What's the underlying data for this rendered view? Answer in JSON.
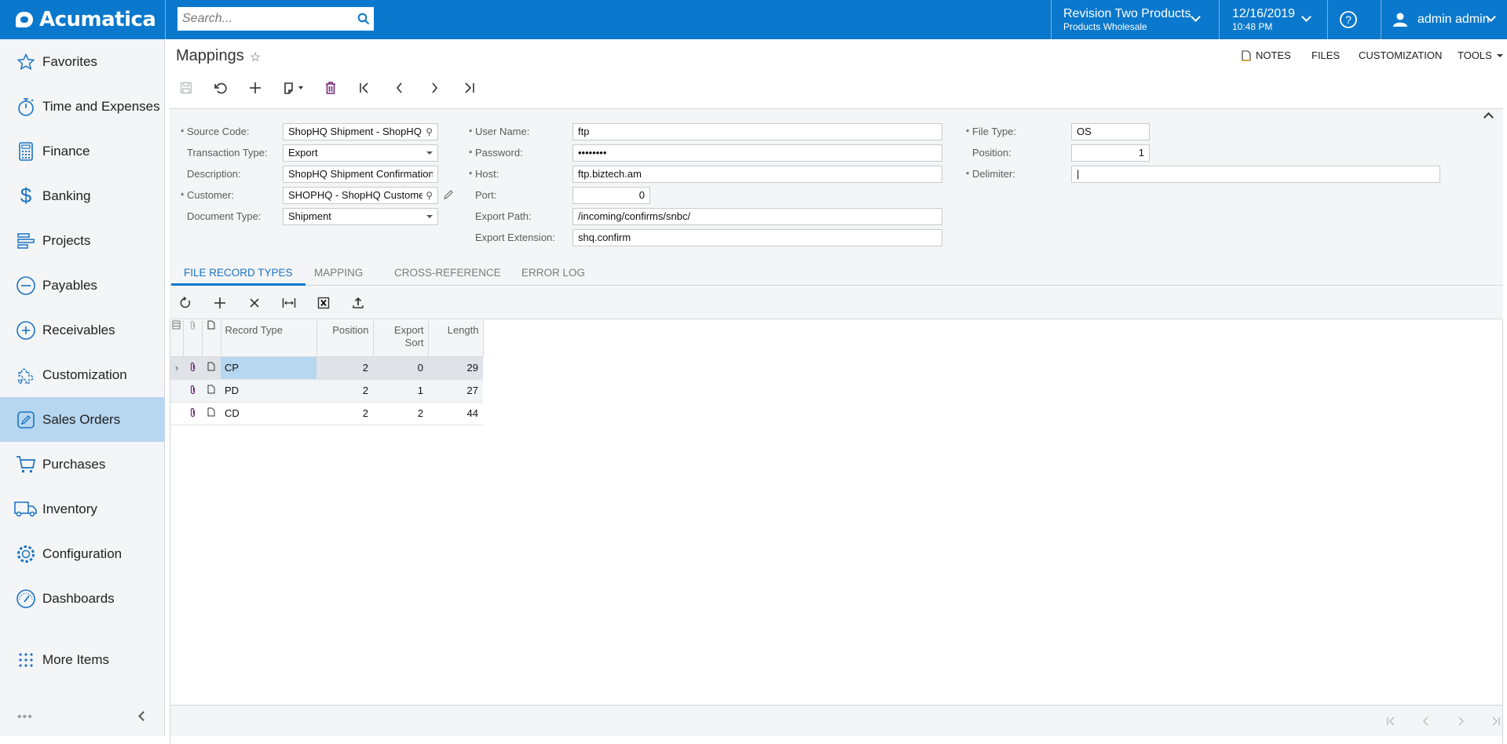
{
  "header": {
    "brand": "Acumatica",
    "search_placeholder": "Search...",
    "company": {
      "name": "Revision Two Products",
      "branch": "Products Wholesale"
    },
    "datetime": {
      "date": "12/16/2019",
      "time": "10:48 PM"
    },
    "user": "admin admin",
    "brand_color": "#0a78cc"
  },
  "sidebar": {
    "items": [
      {
        "label": "Favorites",
        "icon": "star-icon"
      },
      {
        "label": "Time and Expenses",
        "icon": "stopwatch-icon"
      },
      {
        "label": "Finance",
        "icon": "calculator-icon"
      },
      {
        "label": "Banking",
        "icon": "dollar-icon"
      },
      {
        "label": "Projects",
        "icon": "projects-icon"
      },
      {
        "label": "Payables",
        "icon": "minus-circle-icon"
      },
      {
        "label": "Receivables",
        "icon": "plus-circle-icon"
      },
      {
        "label": "Customization",
        "icon": "puzzle-icon"
      },
      {
        "label": "Sales Orders",
        "icon": "pencil-square-icon",
        "active": true
      },
      {
        "label": "Purchases",
        "icon": "cart-icon"
      },
      {
        "label": "Inventory",
        "icon": "truck-icon"
      },
      {
        "label": "Configuration",
        "icon": "gear-icon"
      },
      {
        "label": "Dashboards",
        "icon": "gauge-icon"
      },
      {
        "label": "More Items",
        "icon": "grid-dots-icon"
      }
    ]
  },
  "page": {
    "title": "Mappings",
    "right_tools": {
      "notes": "NOTES",
      "files": "FILES",
      "customization": "CUSTOMIZATION",
      "tools": "TOOLS"
    }
  },
  "form": {
    "source_code": {
      "label": "Source Code:",
      "value": "ShopHQ Shipment - ShopHQ",
      "required": true
    },
    "transaction_type": {
      "label": "Transaction Type:",
      "value": "Export"
    },
    "description": {
      "label": "Description:",
      "value": "ShopHQ Shipment Confirmation"
    },
    "customer": {
      "label": "Customer:",
      "value": "SHOPHQ - ShopHQ Customer",
      "required": true
    },
    "document_type": {
      "label": "Document Type:",
      "value": "Shipment"
    },
    "user_name": {
      "label": "User Name:",
      "value": "ftp",
      "required": true
    },
    "password": {
      "label": "Password:",
      "value": "••••••••",
      "required": true
    },
    "host": {
      "label": "Host:",
      "value": "ftp.biztech.am",
      "required": true
    },
    "port": {
      "label": "Port:",
      "value": "0"
    },
    "export_path": {
      "label": "Export Path:",
      "value": "/incoming/confirms/snbc/"
    },
    "export_extension": {
      "label": "Export Extension:",
      "value": "shq.confirm"
    },
    "file_type": {
      "label": "File Type:",
      "value": "OS",
      "required": true
    },
    "position": {
      "label": "Position:",
      "value": "1"
    },
    "delimiter": {
      "label": "Delimiter:",
      "value": "|",
      "required": true
    }
  },
  "tabs": [
    {
      "label": "FILE RECORD TYPES",
      "active": true
    },
    {
      "label": "MAPPING"
    },
    {
      "label": "CROSS-REFERENCE"
    },
    {
      "label": "ERROR LOG"
    }
  ],
  "grid": {
    "columns": [
      "Record Type",
      "Position",
      "Export Sort",
      "Length"
    ],
    "rows": [
      {
        "record_type": "CP",
        "position": "2",
        "export_sort": "0",
        "length": "29"
      },
      {
        "record_type": "PD",
        "position": "2",
        "export_sort": "1",
        "length": "27"
      },
      {
        "record_type": "CD",
        "position": "2",
        "export_sort": "2",
        "length": "44"
      }
    ]
  }
}
